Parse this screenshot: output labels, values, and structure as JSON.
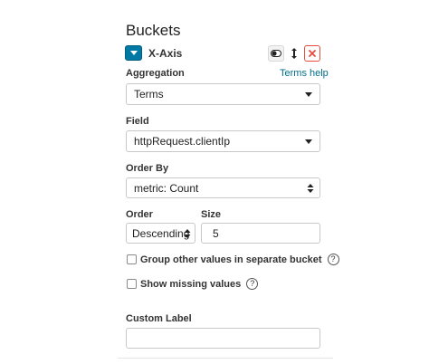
{
  "section_title": "Buckets",
  "aggregation_header": {
    "label": "X-Axis",
    "actions": {
      "toggle_icon": "toggle-icon",
      "drag_icon": "drag-vertical-icon",
      "remove_icon": "remove-x-icon"
    }
  },
  "aggregation": {
    "label": "Aggregation",
    "help_link": "Terms help",
    "selected": "Terms"
  },
  "field": {
    "label": "Field",
    "selected": "httpRequest.clientIp"
  },
  "order_by": {
    "label": "Order By",
    "selected": "metric: Count"
  },
  "order": {
    "label": "Order",
    "selected": "Descending"
  },
  "size": {
    "label": "Size",
    "value": "5"
  },
  "options": {
    "group_other": "Group other values in separate bucket",
    "show_missing": "Show missing values",
    "help_icon_text": "?"
  },
  "custom_label": {
    "label": "Custom Label",
    "value": ""
  },
  "colors": {
    "accent": "#0079a5",
    "link": "#006e8a",
    "danger": "#e74c3c"
  }
}
